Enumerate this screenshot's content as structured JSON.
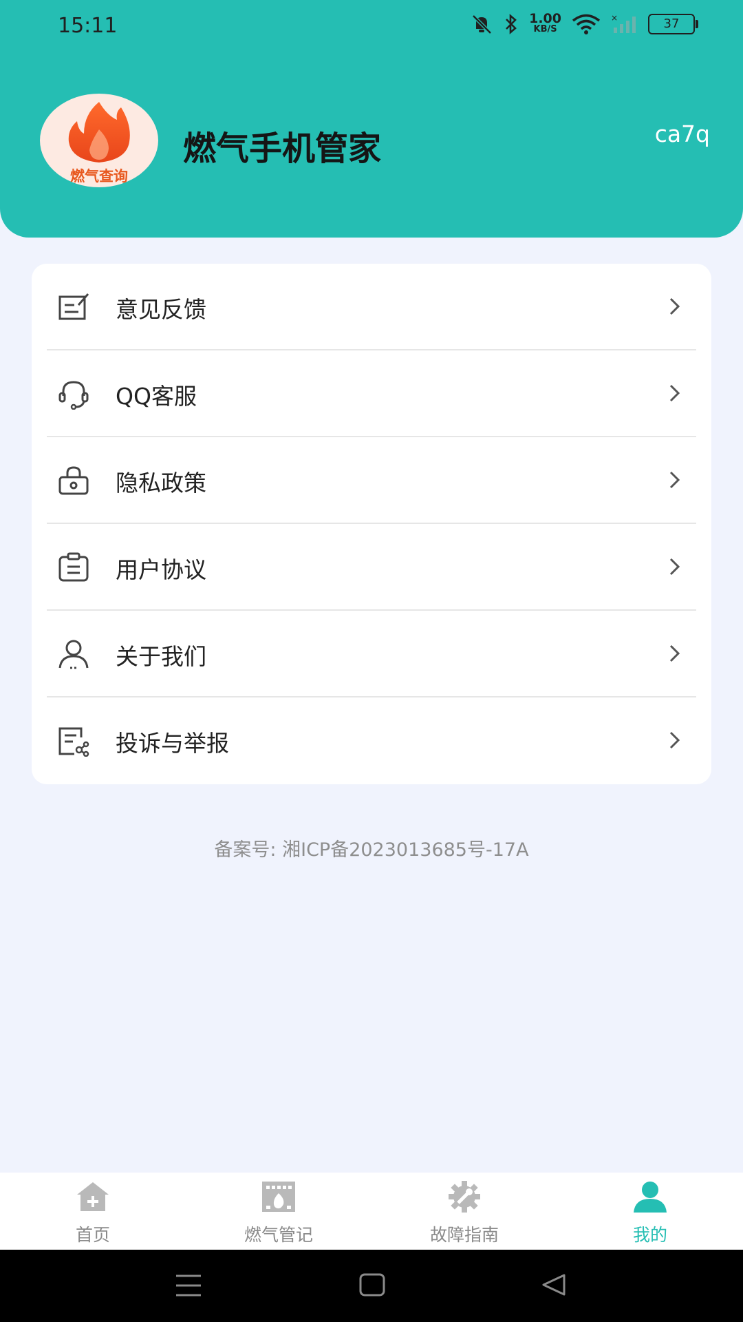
{
  "status_bar": {
    "time": "15:11",
    "net_speed_value": "1.00",
    "net_speed_unit": "KB/S",
    "battery": "37"
  },
  "header": {
    "avatar_text": "燃气查询",
    "app_title": "燃气手机管家",
    "user_code": "ca7q",
    "bg_color": "#25beb3"
  },
  "menu": {
    "items": [
      {
        "label": "意见反馈",
        "icon": "feedback-icon"
      },
      {
        "label": "QQ客服",
        "icon": "headset-icon"
      },
      {
        "label": "隐私政策",
        "icon": "lock-icon"
      },
      {
        "label": "用户协议",
        "icon": "clipboard-icon"
      },
      {
        "label": "关于我们",
        "icon": "user-icon"
      },
      {
        "label": "投诉与举报",
        "icon": "report-icon"
      }
    ]
  },
  "footer": {
    "icp": "备案号:  湘ICP备2023013685号-17A"
  },
  "tabbar": {
    "tabs": [
      {
        "label": "首页",
        "icon": "home-icon"
      },
      {
        "label": "燃气管记",
        "icon": "stove-icon"
      },
      {
        "label": "故障指南",
        "icon": "wrench-gear-icon"
      },
      {
        "label": "我的",
        "icon": "profile-icon"
      }
    ],
    "active_color": "#25beb3",
    "inactive_color": "#8a8a8a"
  }
}
